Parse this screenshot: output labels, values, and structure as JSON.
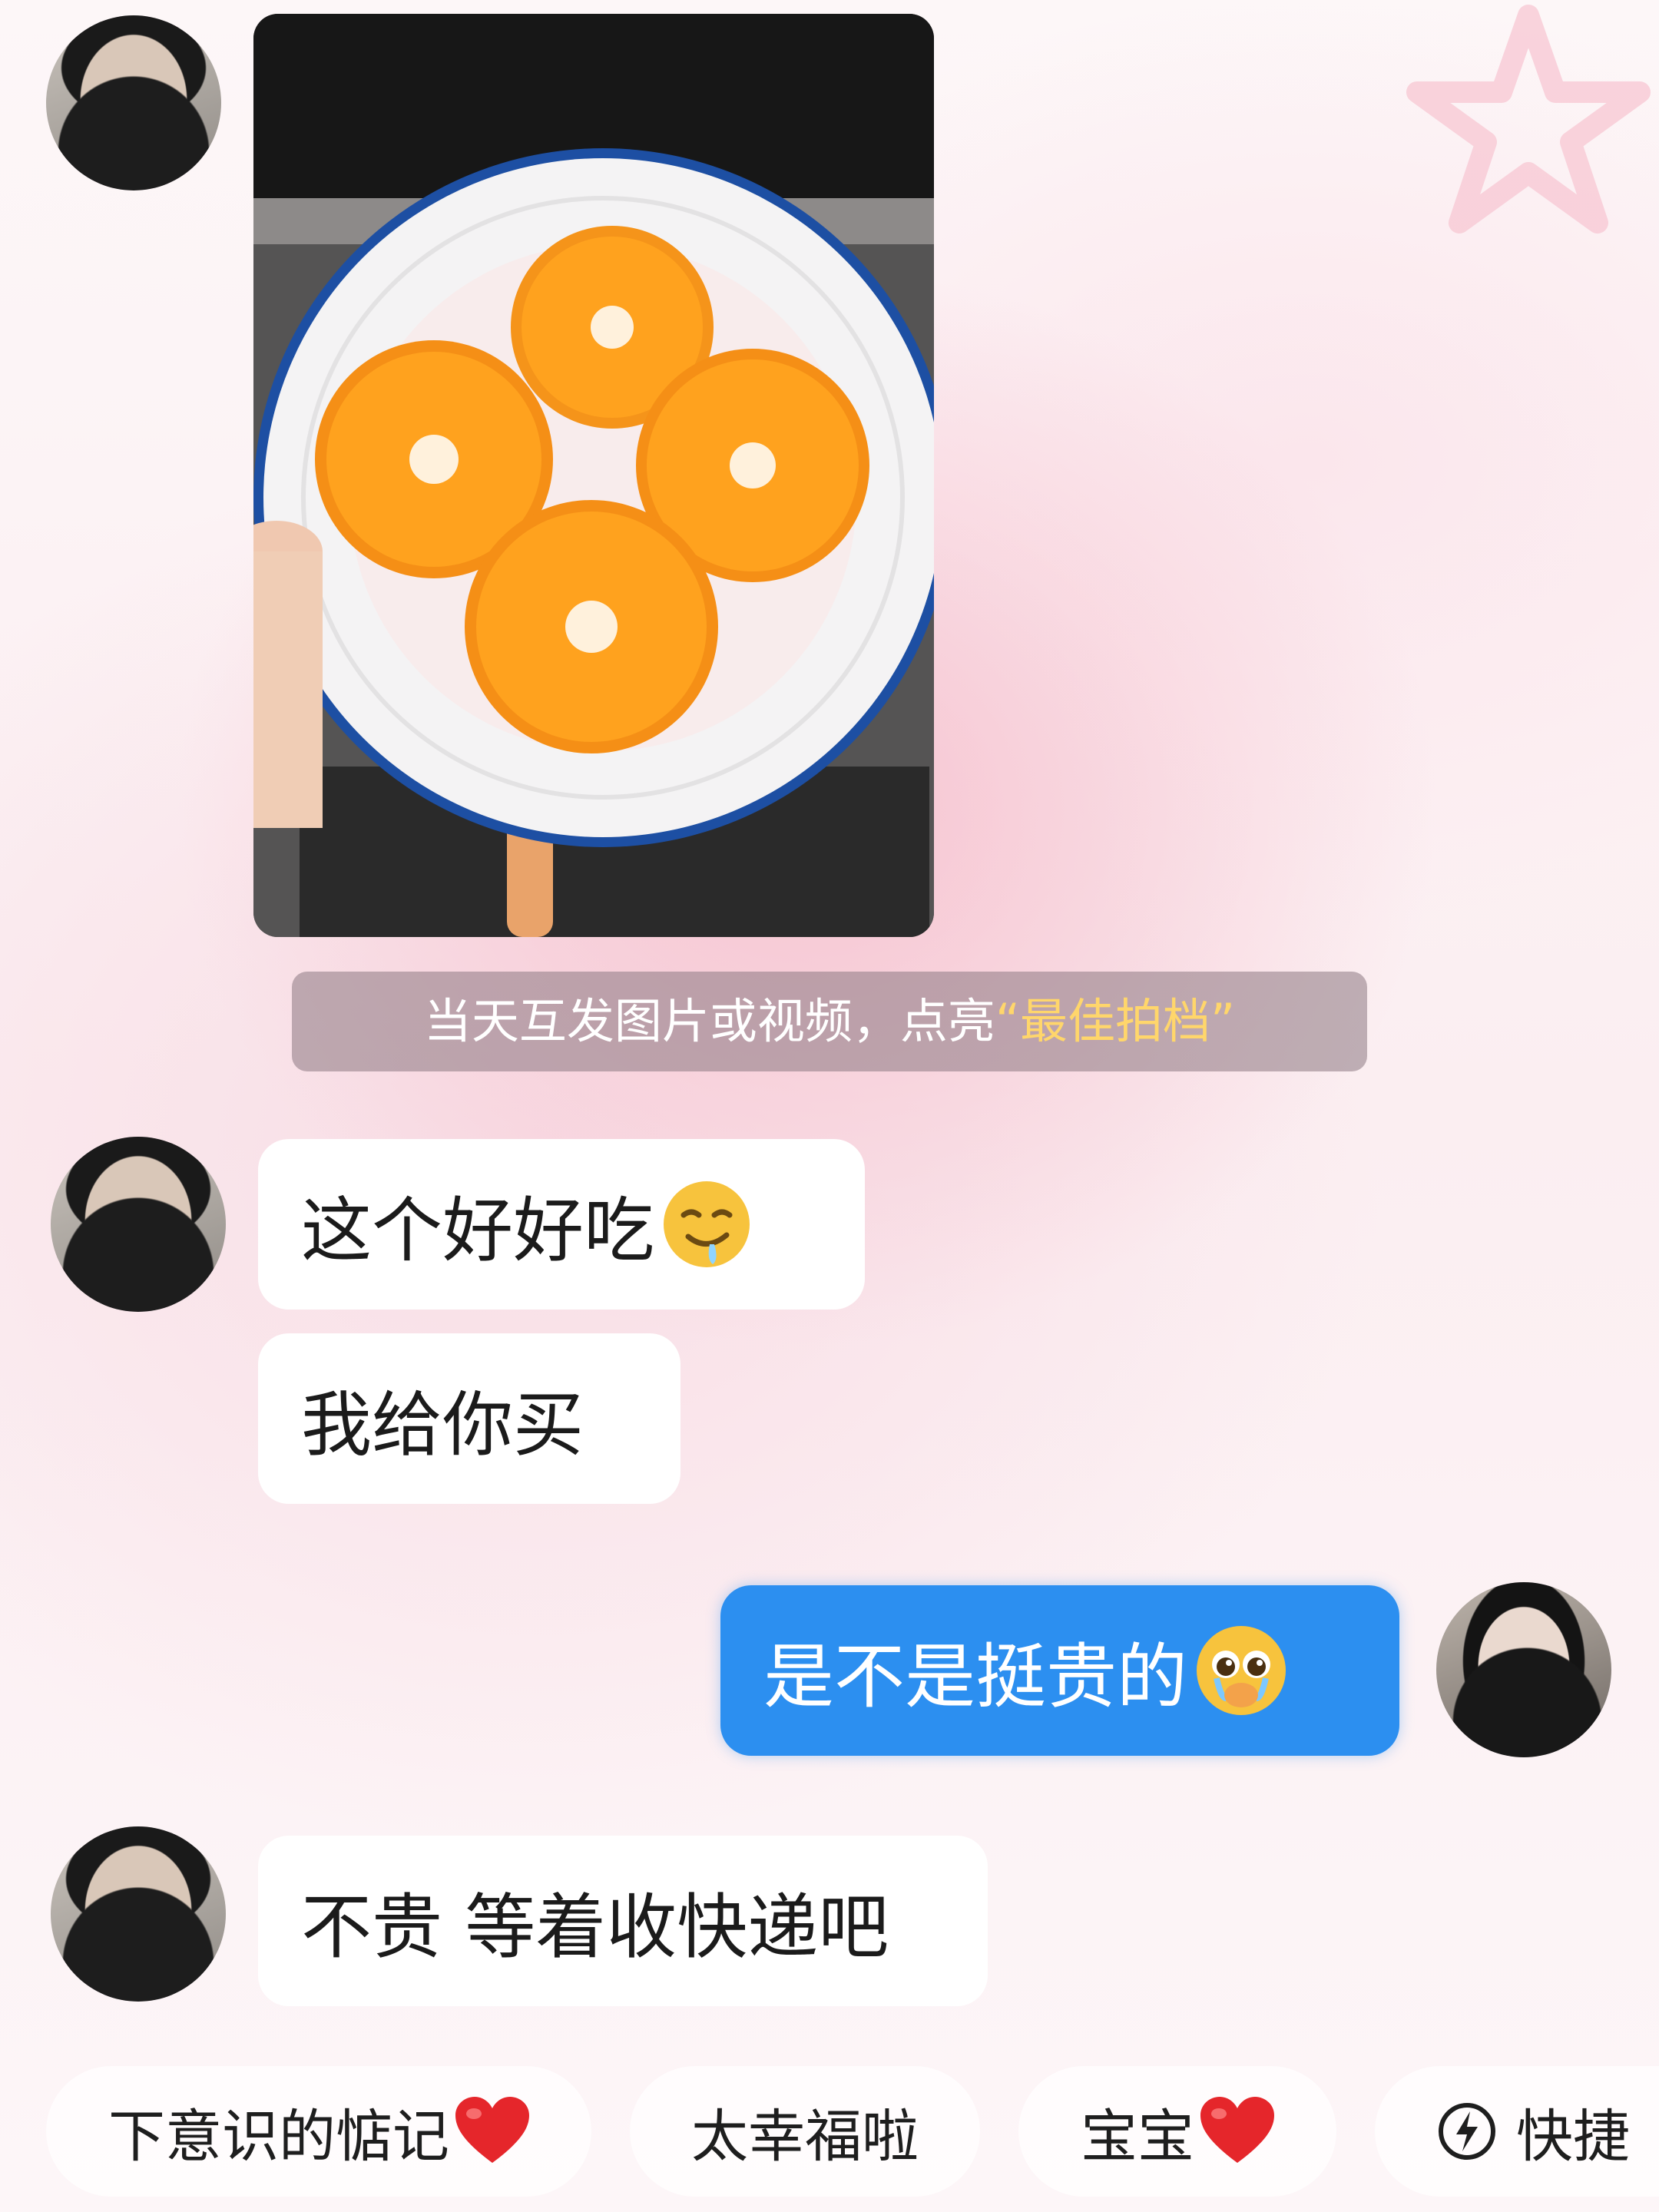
{
  "system_tip": {
    "prefix": "当天互发图片或视频，点亮",
    "open_quote": "“",
    "highlight": "最佳拍档",
    "close_quote": "”"
  },
  "messages": [
    {
      "side": "in",
      "text": "这个好好吃",
      "emoji": "drooling-face-icon"
    },
    {
      "side": "in",
      "text": "我给你买"
    },
    {
      "side": "out",
      "text": "是不是挺贵的",
      "emoji": "pleading-face-icon"
    },
    {
      "side": "in",
      "text": "不贵 等着收快递吧"
    }
  ],
  "quick_replies": [
    {
      "label": "下意识的惦记",
      "icon": "heart-icon"
    },
    {
      "label": "太幸福啦"
    },
    {
      "label": "宝宝",
      "icon": "heart-icon"
    },
    {
      "label": "快捷",
      "icon": "lightning-icon"
    }
  ],
  "colors": {
    "outgoing_bubble": "#2c8ff0",
    "incoming_bubble": "#ffffff",
    "highlight_text": "#ffd66b"
  }
}
